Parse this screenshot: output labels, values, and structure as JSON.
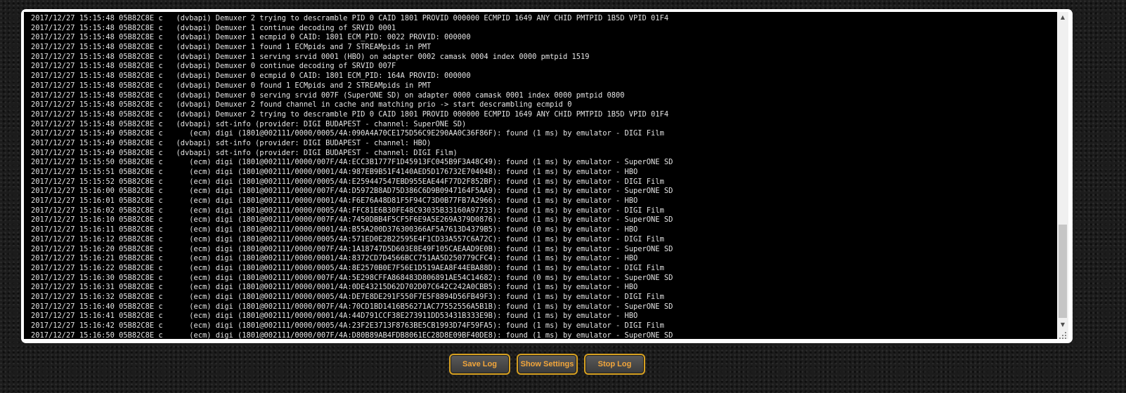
{
  "log": {
    "lines": [
      "2017/12/27 15:15:48 05B82C8E c   (dvbapi) Demuxer 2 trying to descramble PID 0 CAID 1801 PROVID 000000 ECMPID 1649 ANY CHID PMTPID 1B5D VPID 01F4",
      "2017/12/27 15:15:48 05B82C8E c   (dvbapi) Demuxer 1 continue decoding of SRVID 0001",
      "2017/12/27 15:15:48 05B82C8E c   (dvbapi) Demuxer 1 ecmpid 0 CAID: 1801 ECM_PID: 0022 PROVID: 000000",
      "2017/12/27 15:15:48 05B82C8E c   (dvbapi) Demuxer 1 found 1 ECMpids and 7 STREAMpids in PMT",
      "2017/12/27 15:15:48 05B82C8E c   (dvbapi) Demuxer 1 serving srvid 0001 (HBO) on adapter 0002 camask 0004 index 0000 pmtpid 1519",
      "2017/12/27 15:15:48 05B82C8E c   (dvbapi) Demuxer 0 continue decoding of SRVID 007F",
      "2017/12/27 15:15:48 05B82C8E c   (dvbapi) Demuxer 0 ecmpid 0 CAID: 1801 ECM_PID: 164A PROVID: 000000",
      "2017/12/27 15:15:48 05B82C8E c   (dvbapi) Demuxer 0 found 1 ECMpids and 2 STREAMpids in PMT",
      "2017/12/27 15:15:48 05B82C8E c   (dvbapi) Demuxer 0 serving srvid 007F (SuperONE SD) on adapter 0000 camask 0001 index 0000 pmtpid 0800",
      "2017/12/27 15:15:48 05B82C8E c   (dvbapi) Demuxer 2 found channel in cache and matching prio -> start descrambling ecmpid 0",
      "2017/12/27 15:15:48 05B82C8E c   (dvbapi) Demuxer 2 trying to descramble PID 0 CAID 1801 PROVID 000000 ECMPID 1649 ANY CHID PMTPID 1B5D VPID 01F4",
      "2017/12/27 15:15:48 05B82C8E c   (dvbapi) sdt-info (provider: DIGI BUDAPEST - channel: SuperONE SD)",
      "2017/12/27 15:15:49 05B82C8E c      (ecm) digi (1801@002111/0000/0005/4A:090A4A70CE175D56C9E290AA0C36F86F): found (1 ms) by emulator - DIGI Film",
      "2017/12/27 15:15:49 05B82C8E c   (dvbapi) sdt-info (provider: DIGI BUDAPEST - channel: HBO)",
      "2017/12/27 15:15:49 05B82C8E c   (dvbapi) sdt-info (provider: DIGI BUDAPEST - channel: DIGI Film)",
      "2017/12/27 15:15:50 05B82C8E c      (ecm) digi (1801@002111/0000/007F/4A:ECC3B1777F1D45913FC045B9F3A48C49): found (1 ms) by emulator - SuperONE SD",
      "2017/12/27 15:15:51 05B82C8E c      (ecm) digi (1801@002111/0000/0001/4A:987EB9B51F4140AED5D176732E704048): found (1 ms) by emulator - HBO",
      "2017/12/27 15:15:52 05B82C8E c      (ecm) digi (1801@002111/0000/0005/4A:E259447547EBD955EAE44F77D2F852BF): found (1 ms) by emulator - DIGI Film",
      "2017/12/27 15:16:00 05B82C8E c      (ecm) digi (1801@002111/0000/007F/4A:D5972B8AD75D386C6D9B0947164F5AA9): found (1 ms) by emulator - SuperONE SD",
      "2017/12/27 15:16:01 05B82C8E c      (ecm) digi (1801@002111/0000/0001/4A:F6E76A48D81F5F94C73D0B77FB7A2966): found (1 ms) by emulator - HBO",
      "2017/12/27 15:16:02 05B82C8E c      (ecm) digi (1801@002111/0000/0005/4A:FFC81E6B30FE48C93035B33160A97733): found (1 ms) by emulator - DIGI Film",
      "2017/12/27 15:16:10 05B82C8E c      (ecm) digi (1801@002111/0000/007F/4A:7450DBB4F5CF5F6E9A5E269A379D0876): found (1 ms) by emulator - SuperONE SD",
      "2017/12/27 15:16:11 05B82C8E c      (ecm) digi (1801@002111/0000/0001/4A:B55A200D376300366AF5A7613D4379B5): found (0 ms) by emulator - HBO",
      "2017/12/27 15:16:12 05B82C8E c      (ecm) digi (1801@002111/0000/0005/4A:571ED0E2B22595E4F1CD33A557C6A72C): found (1 ms) by emulator - DIGI Film",
      "2017/12/27 15:16:20 05B82C8E c      (ecm) digi (1801@002111/0000/007F/4A:1A18747D5D603E8E49F105CAEAAD9E0B): found (1 ms) by emulator - SuperONE SD",
      "2017/12/27 15:16:21 05B82C8E c      (ecm) digi (1801@002111/0000/0001/4A:8372CD7D4566BCC751AA5D250779CFC4): found (1 ms) by emulator - HBO",
      "2017/12/27 15:16:22 05B82C8E c      (ecm) digi (1801@002111/0000/0005/4A:8E2570B0E7F56E1D519AEA8F44EBA88D): found (1 ms) by emulator - DIGI Film",
      "2017/12/27 15:16:30 05B82C8E c      (ecm) digi (1801@002111/0000/007F/4A:5E298CFFA868483D806891AE54C14682): found (0 ms) by emulator - SuperONE SD",
      "2017/12/27 15:16:31 05B82C8E c      (ecm) digi (1801@002111/0000/0001/4A:0DE43215D62D702D07C642C242A0CBB5): found (1 ms) by emulator - HBO",
      "2017/12/27 15:16:32 05B82C8E c      (ecm) digi (1801@002111/0000/0005/4A:DE7E8DE291F550F7E5F8894D56FB49F3): found (1 ms) by emulator - DIGI Film",
      "2017/12/27 15:16:40 05B82C8E c      (ecm) digi (1801@002111/0000/007F/4A:70CD1BD1416B56271AC77552556A5B1B): found (1 ms) by emulator - SuperONE SD",
      "2017/12/27 15:16:41 05B82C8E c      (ecm) digi (1801@002111/0000/0001/4A:44D791CCF38E273911DD53431B333E9B): found (1 ms) by emulator - HBO",
      "2017/12/27 15:16:42 05B82C8E c      (ecm) digi (1801@002111/0000/0005/4A:23F2E3713F8763BE5CB1993D74F59FA5): found (1 ms) by emulator - DIGI Film",
      "2017/12/27 15:16:50 05B82C8E c      (ecm) digi (1801@002111/0000/007F/4A:D80B89AB4FDB8061EC28D8E09BF40DE8): found (1 ms) by emulator - SuperONE SD"
    ],
    "scroll_position_fraction": 0.67
  },
  "buttons": {
    "save_log": "Save Log",
    "show_settings": "Show Settings",
    "stop_log": "Stop Log"
  },
  "icons": {
    "scroll_up": "triangle-up",
    "scroll_down": "triangle-down",
    "resize": "resize-grip"
  },
  "colors": {
    "page_background": "#1c1c1c",
    "log_background": "#000000",
    "log_text": "#e4e4e4",
    "button_border": "#d6a021",
    "button_text": "#f3a63a"
  }
}
